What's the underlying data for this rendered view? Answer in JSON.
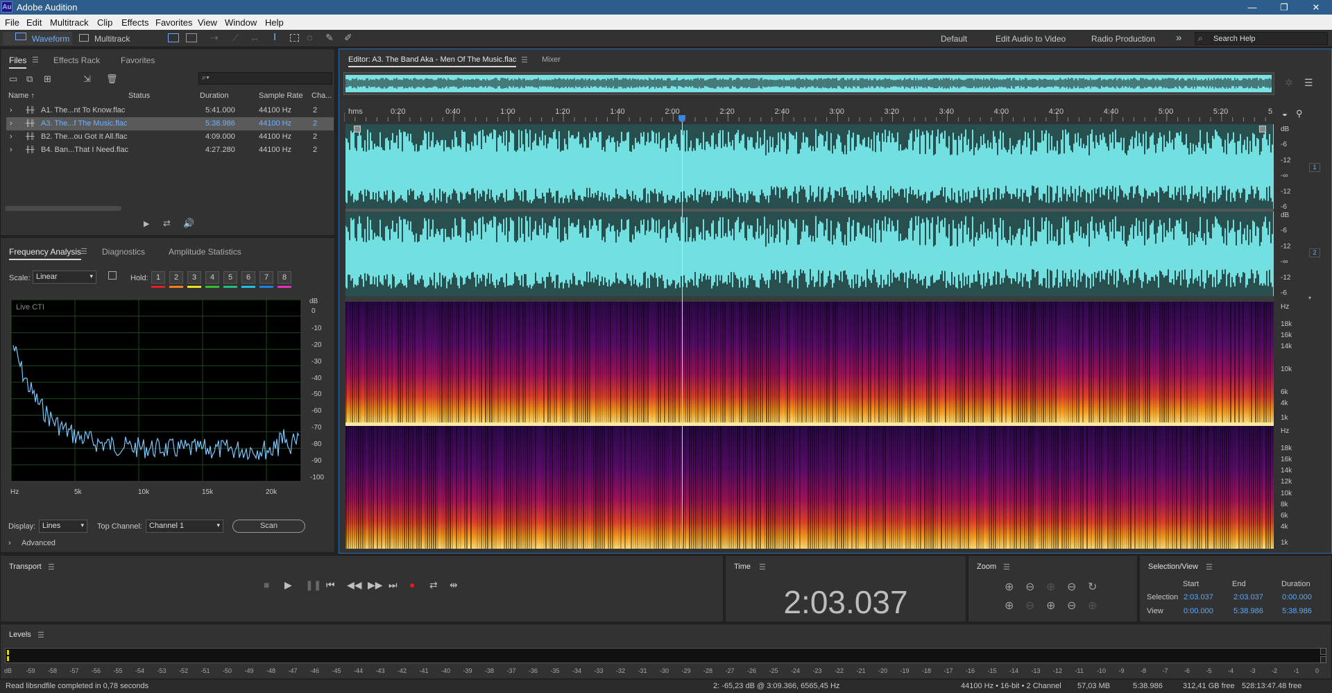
{
  "app": {
    "title": "Adobe Audition",
    "icon_label": "Au"
  },
  "window_buttons": {
    "minimize": "—",
    "restore": "❐",
    "close": "✕"
  },
  "menu": [
    "File",
    "Edit",
    "Multitrack",
    "Clip",
    "Effects",
    "Favorites",
    "View",
    "Window",
    "Help"
  ],
  "toolbar": {
    "waveform": "Waveform",
    "multitrack": "Multitrack",
    "workspaces": [
      "Default",
      "Edit Audio to Video",
      "Radio Production"
    ],
    "more": "»",
    "search_placeholder": "Search Help"
  },
  "files_panel": {
    "tabs": [
      "Files",
      "Effects Rack",
      "Favorites"
    ],
    "search_placeholder": "",
    "columns": [
      "Name ↑",
      "Status",
      "Duration",
      "Sample Rate",
      "Cha..."
    ],
    "rows": [
      {
        "name": "A1. The...nt To Know.flac",
        "duration": "5:41.000",
        "rate": "44100 Hz",
        "ch": "2"
      },
      {
        "name": "A3. The...f The Music.flac",
        "duration": "5:38.986",
        "rate": "44100 Hz",
        "ch": "2"
      },
      {
        "name": "B2. The...ou Got It All.flac",
        "duration": "4:09.000",
        "rate": "44100 Hz",
        "ch": "2"
      },
      {
        "name": "B4. Ban...That I Need.flac",
        "duration": "4:27.280",
        "rate": "44100 Hz",
        "ch": "2"
      }
    ],
    "selected_index": 1
  },
  "freq_panel": {
    "tabs": [
      "Frequency Analysis",
      "Diagnostics",
      "Amplitude Statistics"
    ],
    "scale_label": "Scale:",
    "scale_value": "Linear",
    "hold_label": "Hold:",
    "hold_buttons": [
      "1",
      "2",
      "3",
      "4",
      "5",
      "6",
      "7",
      "8"
    ],
    "hold_colors": [
      "#e02020",
      "#f08020",
      "#f0e020",
      "#30c030",
      "#20c080",
      "#20c0e0",
      "#2080e0",
      "#e030c0"
    ],
    "graph_label": "Live CTI",
    "db_label": "dB",
    "db_ticks": [
      "0",
      "-10",
      "-20",
      "-30",
      "-40",
      "-50",
      "-60",
      "-70",
      "-80",
      "-90",
      "-100"
    ],
    "hz_ticks": [
      "Hz",
      "5k",
      "10k",
      "15k",
      "20k"
    ],
    "display_label": "Display:",
    "display_value": "Lines",
    "top_channel_label": "Top Channel:",
    "top_channel_value": "Channel 1",
    "scan_label": "Scan",
    "advanced_label": "Advanced"
  },
  "editor": {
    "tab_label": "Editor: A3. The Band Aka - Men Of The Music.flac",
    "mixer_label": "Mixer",
    "time_ruler": [
      "hms",
      "0:20",
      "0:40",
      "1:00",
      "1:20",
      "1:40",
      "2:00",
      "2:20",
      "2:40",
      "3:00",
      "3:20",
      "3:40",
      "4:00",
      "4:20",
      "4:40",
      "5:00",
      "5:20",
      "5"
    ],
    "wave_db_labels": [
      "dB",
      "-6",
      "-12",
      "-∞",
      "-12",
      "-6"
    ],
    "channel_badges": [
      "1",
      "2"
    ],
    "spec_hz_labels_1": [
      "Hz",
      "18k",
      "16k",
      "14k",
      "10k",
      "6k",
      "4k",
      "1k"
    ],
    "spec_hz_labels_2": [
      "Hz",
      "18k",
      "16k",
      "14k",
      "12k",
      "10k",
      "8k",
      "6k",
      "4k",
      "1k"
    ],
    "playhead_fraction": 0.3627,
    "wave_color": "#72e0e0"
  },
  "transport": {
    "title": "Transport"
  },
  "time_panel": {
    "title": "Time",
    "value": "2:03.037"
  },
  "zoom_panel": {
    "title": "Zoom"
  },
  "selview": {
    "title": "Selection/View",
    "headers": [
      "Start",
      "End",
      "Duration"
    ],
    "selection_label": "Selection",
    "selection": [
      "2:03.037",
      "2:03.037",
      "0:00.000"
    ],
    "view_label": "View",
    "view": [
      "0:00.000",
      "5:38.986",
      "5:38.986"
    ]
  },
  "levels": {
    "title": "Levels",
    "ticks": [
      "dB",
      "-59",
      "-58",
      "-57",
      "-56",
      "-55",
      "-54",
      "-53",
      "-52",
      "-51",
      "-50",
      "-49",
      "-48",
      "-47",
      "-46",
      "-45",
      "-44",
      "-43",
      "-42",
      "-41",
      "-40",
      "-39",
      "-38",
      "-37",
      "-36",
      "-35",
      "-34",
      "-33",
      "-32",
      "-31",
      "-30",
      "-29",
      "-28",
      "-27",
      "-26",
      "-25",
      "-24",
      "-23",
      "-22",
      "-21",
      "-20",
      "-19",
      "-18",
      "-17",
      "-16",
      "-15",
      "-14",
      "-13",
      "-12",
      "-11",
      "-10",
      "-9",
      "-8",
      "-7",
      "-6",
      "-5",
      "-4",
      "-3",
      "-2",
      "-1",
      "0"
    ]
  },
  "status": {
    "left": "Read libsndfile completed in 0,78 seconds",
    "cursor": "2: -65,23 dB @ 3:09.366, 6565,45 Hz",
    "format": "44100 Hz • 16-bit • 2 Channel",
    "size": "57,03 MB",
    "duration": "5:38.986",
    "free": "312,41 GB free",
    "free_time": "528:13:47.48 free"
  }
}
